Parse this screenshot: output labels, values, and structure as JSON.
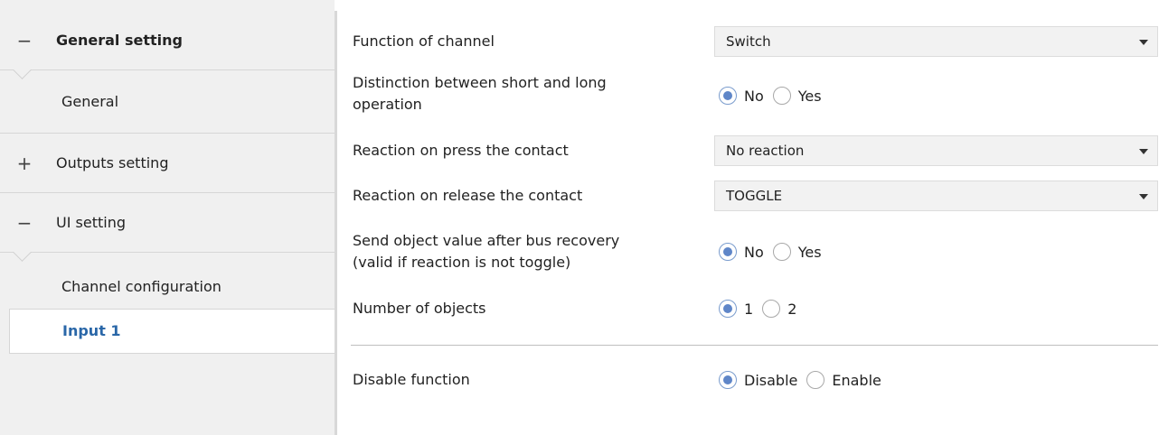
{
  "sidebar": {
    "items": [
      {
        "label": "General setting",
        "sign": "−"
      },
      {
        "label": "General"
      },
      {
        "label": "Outputs setting",
        "sign": "+"
      },
      {
        "label": "UI setting",
        "sign": "−"
      },
      {
        "label": "Channel configuration"
      },
      {
        "label": "Input 1"
      }
    ]
  },
  "form": {
    "function_of_channel": {
      "label": "Function of channel",
      "value": "Switch"
    },
    "distinction": {
      "label_line1": "Distinction between short and long",
      "label_line2": "operation",
      "options": [
        "No",
        "Yes"
      ],
      "selected": "No"
    },
    "reaction_press": {
      "label": "Reaction on press the contact",
      "value": "No reaction"
    },
    "reaction_release": {
      "label": "Reaction on release the contact",
      "value": "TOGGLE"
    },
    "send_after_recovery": {
      "label_line1": "Send object value after bus recovery",
      "label_line2": "(valid if reaction is not toggle)",
      "options": [
        "No",
        "Yes"
      ],
      "selected": "No"
    },
    "number_of_objects": {
      "label": "Number of objects",
      "options": [
        "1",
        "2"
      ],
      "selected": "1"
    },
    "disable_function": {
      "label": "Disable function",
      "options": [
        "Disable",
        "Enable"
      ],
      "selected": "Disable"
    }
  },
  "colors": {
    "accent": "#2a67a8",
    "radio_dot": "#5f86c8",
    "sidebar_bg": "#f0f0f0"
  }
}
